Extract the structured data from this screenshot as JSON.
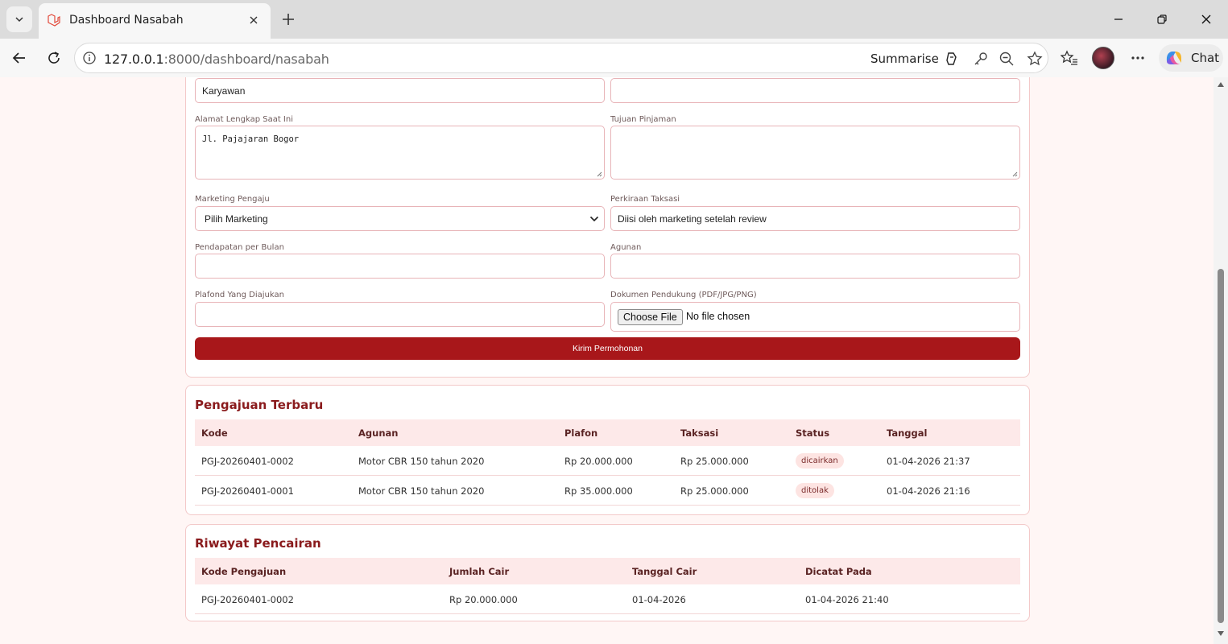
{
  "browser": {
    "tab_title": "Dashboard Nasabah",
    "url_host": "127.0.0.1",
    "url_rest": ":8000/dashboard/nasabah",
    "summarise_label": "Summarise",
    "chat_label": "Chat"
  },
  "form": {
    "pekerjaan_value": "Karyawan",
    "alamat_label": "Alamat Lengkap Saat Ini",
    "alamat_value": "Jl. Pajajaran Bogor",
    "tujuan_label": "Tujuan Pinjaman",
    "tujuan_value": "",
    "marketing_label": "Marketing Pengaju",
    "marketing_selected": "Pilih Marketing",
    "taksasi_label": "Perkiraan Taksasi",
    "taksasi_value": "Diisi oleh marketing setelah review",
    "pendapatan_label": "Pendapatan per Bulan",
    "pendapatan_value": "",
    "agunan_label": "Agunan",
    "agunan_value": "",
    "plafond_label": "Plafond Yang Diajukan",
    "plafond_value": "",
    "dokumen_label": "Dokumen Pendukung (PDF/JPG/PNG)",
    "choose_file_label": "Choose File",
    "file_status": "No file chosen",
    "submit_label": "Kirim Permohonan"
  },
  "pengajuan": {
    "title": "Pengajuan Terbaru",
    "headers": [
      "Kode",
      "Agunan",
      "Plafon",
      "Taksasi",
      "Status",
      "Tanggal"
    ],
    "rows": [
      {
        "kode": "PGJ-20260401-0002",
        "agunan": "Motor CBR 150 tahun 2020",
        "plafon": "Rp 20.000.000",
        "taksasi": "Rp 25.000.000",
        "status": "dicairkan",
        "tanggal": "01-04-2026 21:37"
      },
      {
        "kode": "PGJ-20260401-0001",
        "agunan": "Motor CBR 150 tahun 2020",
        "plafon": "Rp 35.000.000",
        "taksasi": "Rp 25.000.000",
        "status": "ditolak",
        "tanggal": "01-04-2026 21:16"
      }
    ]
  },
  "pencairan": {
    "title": "Riwayat Pencairan",
    "headers": [
      "Kode Pengajuan",
      "Jumlah Cair",
      "Tanggal Cair",
      "Dicatat Pada"
    ],
    "rows": [
      {
        "kode": "PGJ-20260401-0002",
        "jumlah": "Rp 20.000.000",
        "tanggal_cair": "01-04-2026",
        "dicatat": "01-04-2026 21:40"
      }
    ]
  }
}
